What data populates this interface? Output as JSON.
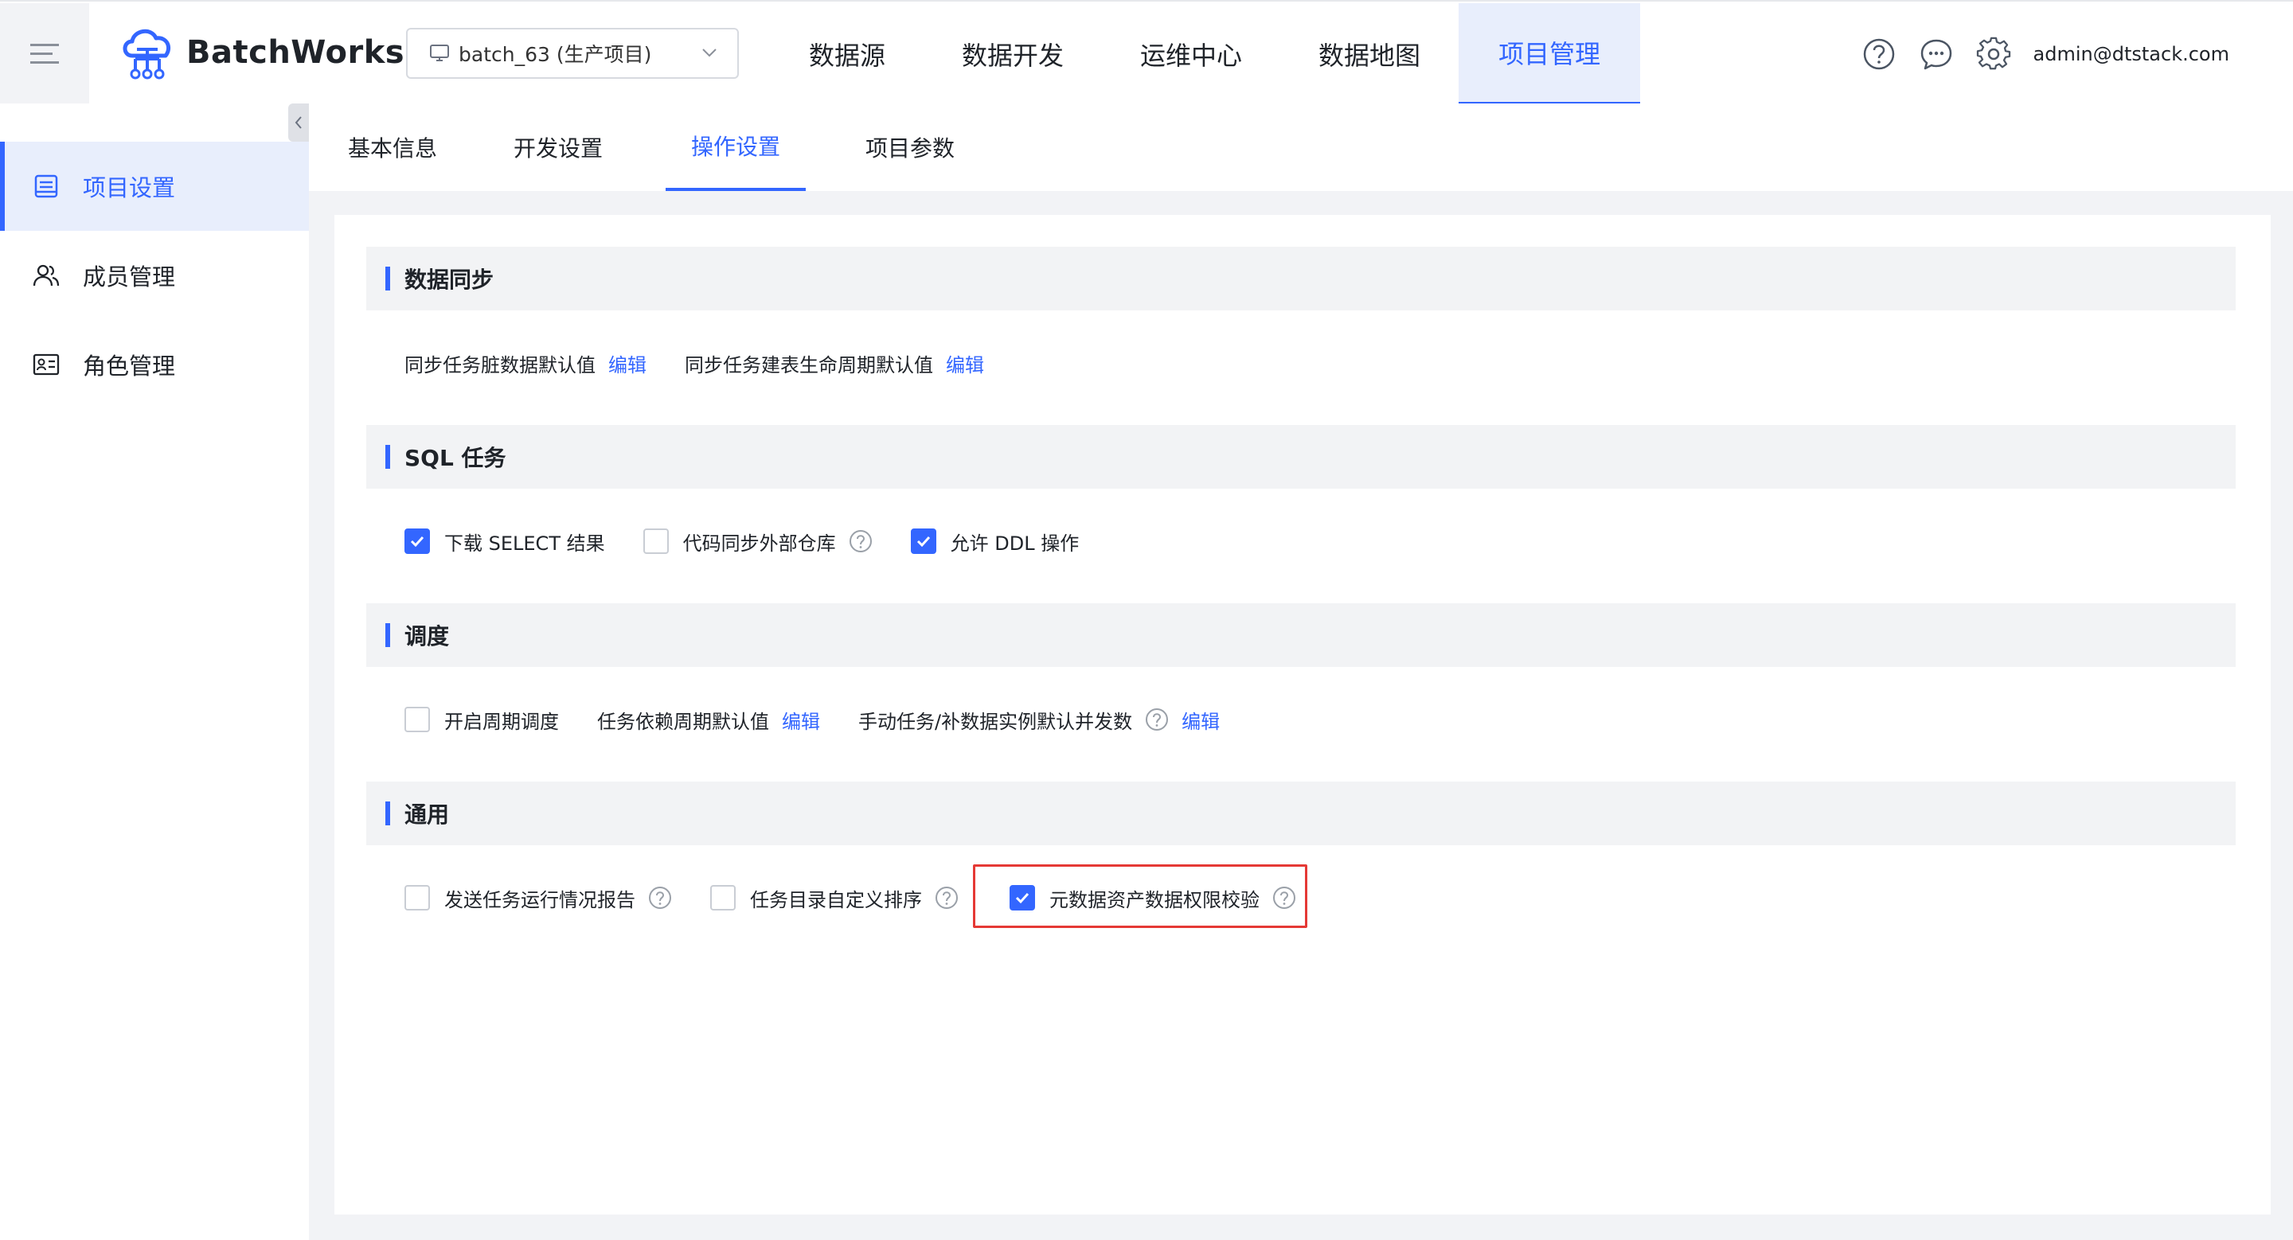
{
  "app": {
    "name": "BatchWorks"
  },
  "header": {
    "project_select": "batch_63 (生产项目)",
    "nav": [
      "数据源",
      "数据开发",
      "运维中心",
      "数据地图",
      "项目管理"
    ],
    "active_nav": "项目管理",
    "user_email": "admin@dtstack.com",
    "icons": [
      "help-circle-icon",
      "message-icon",
      "settings-icon"
    ]
  },
  "sidebar": {
    "items": [
      {
        "label": "项目设置",
        "icon": "project-settings-icon",
        "active": true
      },
      {
        "label": "成员管理",
        "icon": "members-icon",
        "active": false
      },
      {
        "label": "角色管理",
        "icon": "role-card-icon",
        "active": false
      }
    ]
  },
  "tabs": {
    "items": [
      "基本信息",
      "开发设置",
      "操作设置",
      "项目参数"
    ],
    "active": "操作设置"
  },
  "sections": {
    "sync": {
      "title": "数据同步",
      "dirty_default": "同步任务脏数据默认值",
      "lifecycle_default": "同步任务建表生命周期默认值",
      "edit": "编辑"
    },
    "sql": {
      "title": "SQL 任务",
      "download_select": {
        "label": "下载 SELECT 结果",
        "checked": true
      },
      "code_sync": {
        "label": "代码同步外部仓库",
        "checked": false
      },
      "allow_ddl": {
        "label": "允许 DDL 操作",
        "checked": true
      }
    },
    "schedule": {
      "title": "调度",
      "periodic": {
        "label": "开启周期调度",
        "checked": false
      },
      "dependency_default": "任务依赖周期默认值",
      "concurrency_default": "手动任务/补数据实例默认并发数",
      "edit": "编辑"
    },
    "general": {
      "title": "通用",
      "send_report": {
        "label": "发送任务运行情况报告",
        "checked": false
      },
      "custom_sort": {
        "label": "任务目录自定义排序",
        "checked": false
      },
      "metadata_check": {
        "label": "元数据资产数据权限校验",
        "checked": true
      }
    }
  },
  "colors": {
    "accent": "#3366ff",
    "highlight": "#e53935"
  }
}
